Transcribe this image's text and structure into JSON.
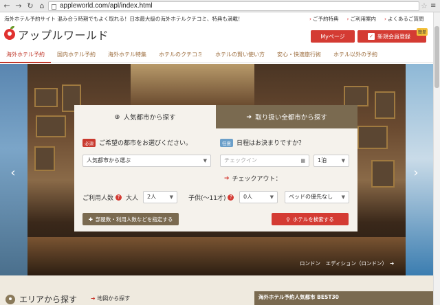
{
  "browser": {
    "url": "appleworld.com/apl/index.html"
  },
  "header": {
    "tagline": "海外ホテル予約サイト 混み合う時期でもよく取れる！日本最大級の海外ホテルクチコミ、特典も満載！",
    "links": [
      "ご予約特典",
      "ご利用案内",
      "よくあるご質問"
    ],
    "logo_text": "アップルワールド",
    "mypage": "Myページ",
    "register": "新規会員登録",
    "register_badge": "簡単"
  },
  "nav": [
    "海外ホテル予約",
    "国内ホテル予約",
    "海外ホテル特集",
    "ホテルのクチコミ",
    "ホテルの賢い使い方",
    "安心・快適旅行術",
    "ホテル以外の予約"
  ],
  "search": {
    "tab_popular": "人気都市から探す",
    "tab_all": "取り扱い全都市から探す",
    "required_tag": "必須",
    "optional_tag": "任意",
    "city_label": "ご希望の都市をお選びください。",
    "date_label": "日程はお決まりですか？",
    "city_select": "人気都市から選ぶ",
    "checkin_placeholder": "チェックイン",
    "nights": "1泊",
    "checkout_label": "チェックアウト：",
    "guests_label": "ご利用人数",
    "adults_label": "大人",
    "adults_value": "2人",
    "children_label": "子供(～11才)",
    "children_value": "0人",
    "bed_value": "ベッドの優先なし",
    "options_button": "部屋数・利用人数などを指定する",
    "search_button": "ホテルを検索する"
  },
  "hero": {
    "caption": "ロンドン　エディション（ロンドン）"
  },
  "bottom": {
    "area_title": "エリアから探す",
    "map_link": "地図から探す",
    "best30": "海外ホテル予約人気都市 BEST30"
  }
}
